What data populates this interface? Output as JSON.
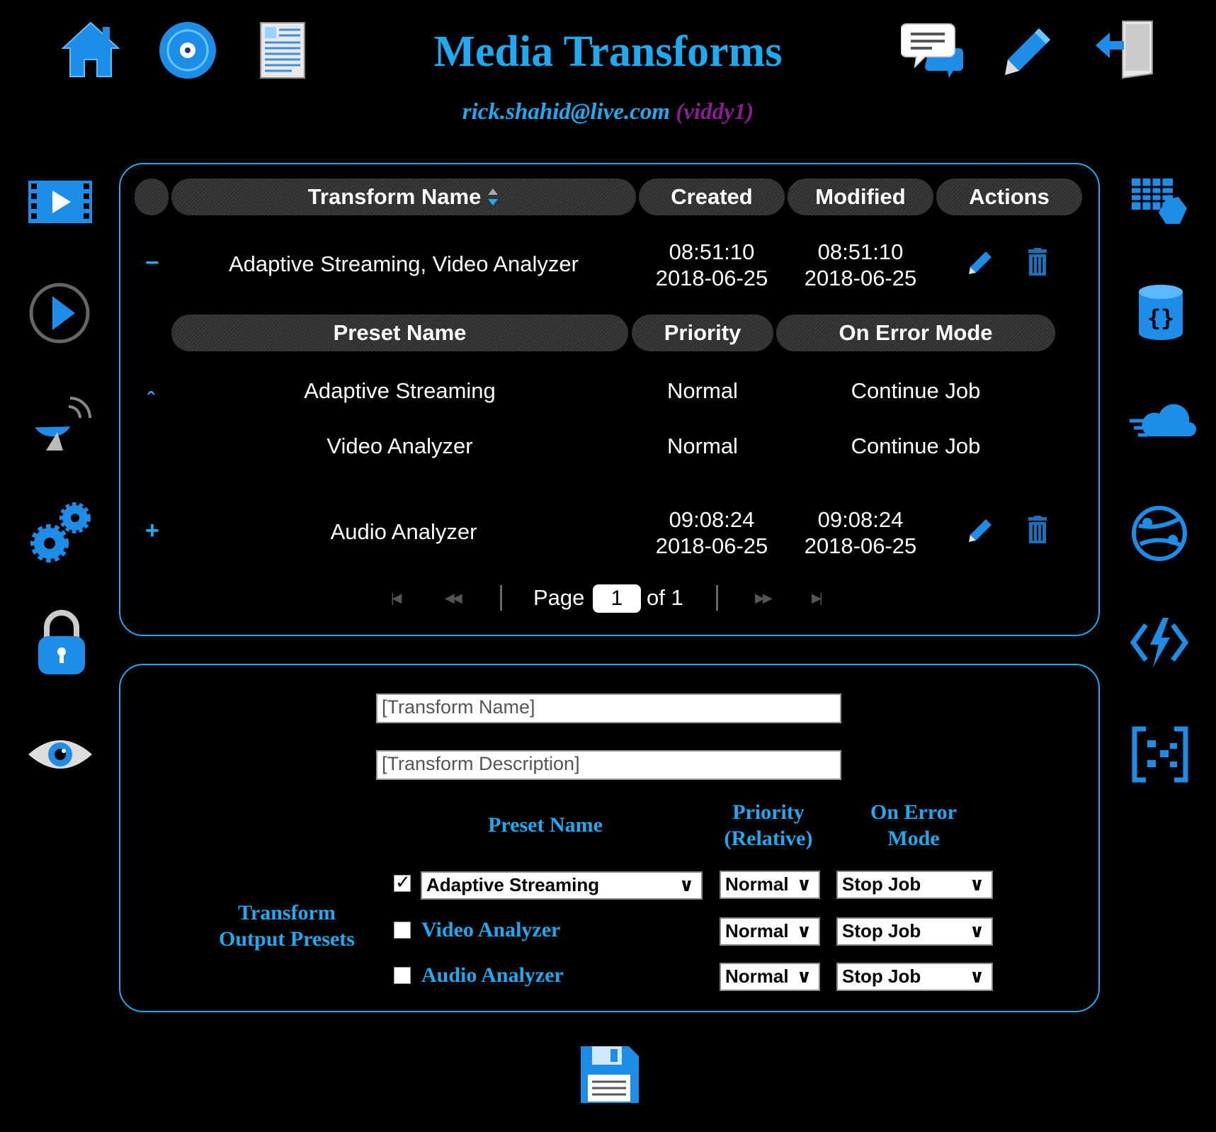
{
  "header": {
    "title": "Media Transforms",
    "account_email": "rick.shahid@live.com",
    "account_alias": "(viddy1)"
  },
  "top_nav_left": [
    "home-icon",
    "disc-icon",
    "document-icon"
  ],
  "top_nav_right": [
    "chat-icon",
    "pencil-icon",
    "sign-out-icon"
  ],
  "left_sidebar": [
    "video-file-icon",
    "play-icon",
    "satellite-dish-icon",
    "gears-icon",
    "lock-icon",
    "eye-icon"
  ],
  "right_sidebar": [
    "table-storage-icon",
    "cosmos-db-icon",
    "cloud-icon",
    "network-globe-icon",
    "function-app-icon",
    "event-grid-icon"
  ],
  "table": {
    "columns": {
      "name": "Transform Name",
      "created": "Created",
      "modified": "Modified",
      "actions": "Actions"
    },
    "rows": [
      {
        "toggle": "−",
        "name": "Adaptive Streaming, Video Analyzer",
        "created_time": "08:51:10",
        "created_date": "2018-06-25",
        "modified_time": "08:51:10",
        "modified_date": "2018-06-25"
      },
      {
        "toggle": "+",
        "name": "Audio Analyzer",
        "created_time": "09:08:24",
        "created_date": "2018-06-25",
        "modified_time": "09:08:24",
        "modified_date": "2018-06-25"
      }
    ],
    "subtable": {
      "columns": {
        "preset": "Preset Name",
        "priority": "Priority",
        "on_error": "On Error Mode"
      },
      "collapse_toggle": "ˆ",
      "rows": [
        {
          "preset": "Adaptive Streaming",
          "priority": "Normal",
          "on_error": "Continue Job"
        },
        {
          "preset": "Video Analyzer",
          "priority": "Normal",
          "on_error": "Continue Job"
        }
      ]
    },
    "pager": {
      "page_label": "Page",
      "page_value": "1",
      "of_label": "of 1"
    }
  },
  "form": {
    "name_placeholder": "[Transform Name]",
    "description_placeholder": "[Transform Description]",
    "headers": {
      "preset": "Preset Name",
      "priority_line1": "Priority",
      "priority_line2": "(Relative)",
      "on_error_line1": "On Error",
      "on_error_line2": "Mode"
    },
    "section_label_line1": "Transform",
    "section_label_line2": "Output Presets",
    "presets": [
      {
        "checked": true,
        "preset": "Adaptive Streaming",
        "priority": "Normal",
        "on_error": "Stop Job"
      },
      {
        "checked": false,
        "preset": "Video Analyzer",
        "priority": "Normal",
        "on_error": "Stop Job"
      },
      {
        "checked": false,
        "preset": "Audio Analyzer",
        "priority": "Normal",
        "on_error": "Stop Job"
      }
    ],
    "save_icon": "floppy-disk-icon"
  },
  "colors": {
    "accent": "#1eaaf1",
    "alias": "#8a1d8f",
    "background": "#000000"
  }
}
